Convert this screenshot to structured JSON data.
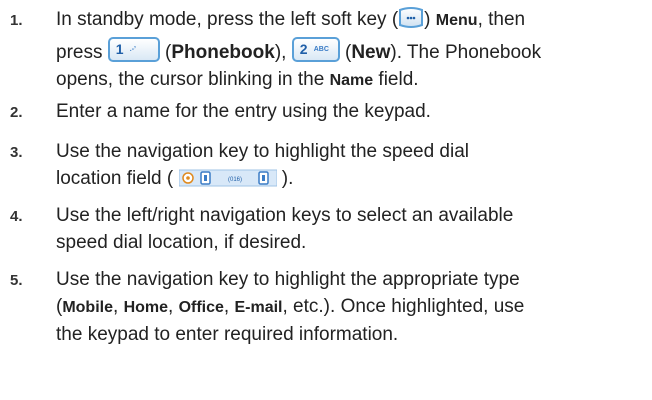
{
  "steps": [
    {
      "num": "1.",
      "l1_a": "In standby mode, press the left soft key (",
      "l1_b": ")",
      "menu": "Menu",
      "l1_c": ", then",
      "l2_a": "press",
      "key1_digit": "1",
      "key1_sym": ".-’",
      "l2_b": " (",
      "phonebook": "Phonebook",
      "l2_c": "),",
      "key2_digit": "2",
      "key2_sym": "ABC",
      "l2_d": " (",
      "new": "New",
      "l2_e": "). The Phonebook",
      "l3_a": "opens, the cursor blinking in the ",
      "name": "Name",
      "l3_b": " field."
    },
    {
      "num": "2.",
      "text": "Enter a name for the entry using the keypad."
    },
    {
      "num": "3.",
      "l1": "Use the navigation key to highlight the speed dial",
      "l2_a": "location field (",
      "field_text": "(016)",
      "l2_b": ")."
    },
    {
      "num": "4.",
      "l1": "Use the left/right navigation keys to select an available",
      "l2": "speed dial location, if desired."
    },
    {
      "num": "5.",
      "l1": "Use the navigation key to highlight the appropriate type",
      "l2_a": "(",
      "mobile": "Mobile",
      "sep1": ", ",
      "home": "Home",
      "sep2": ", ",
      "office": "Office",
      "sep3": ", ",
      "email": "E-mail",
      "l2_b": ", etc.). Once highlighted, use",
      "l3": "the keypad to enter required information."
    }
  ],
  "colors": {
    "text": "#222222",
    "key_border": "#5aa0d8",
    "key_text": "#1f5fa8"
  }
}
